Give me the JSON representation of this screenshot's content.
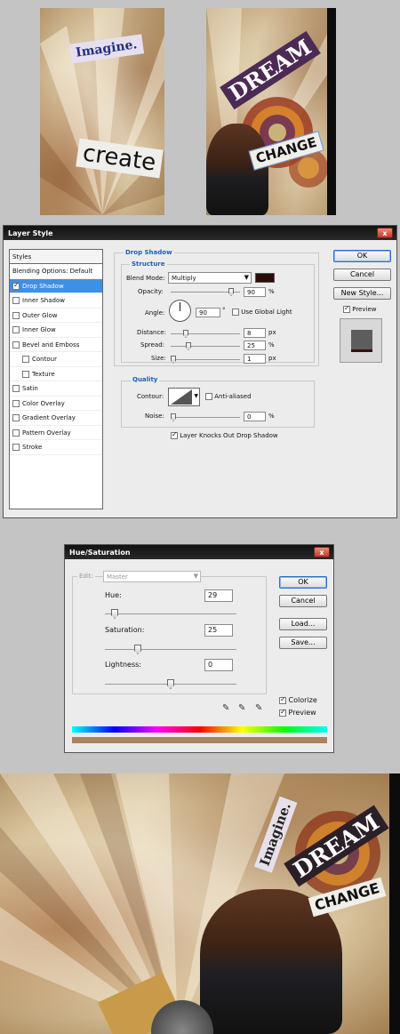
{
  "artwork": {
    "panel1_words": [
      "Imagine.",
      "create"
    ],
    "panel2_words": [
      "DREAM",
      "CHANGE"
    ],
    "final_words": [
      "Imagine.",
      "DREAM",
      "CHANGE"
    ]
  },
  "layer_style": {
    "title": "Layer Style",
    "close_symbol": "x",
    "list_header": "Styles",
    "items": [
      {
        "label": "Blending Options: Default",
        "checkbox": false,
        "checked": false,
        "selected": false,
        "indent": false
      },
      {
        "label": "Drop Shadow",
        "checkbox": true,
        "checked": true,
        "selected": true,
        "indent": false
      },
      {
        "label": "Inner Shadow",
        "checkbox": true,
        "checked": false,
        "selected": false,
        "indent": false
      },
      {
        "label": "Outer Glow",
        "checkbox": true,
        "checked": false,
        "selected": false,
        "indent": false
      },
      {
        "label": "Inner Glow",
        "checkbox": true,
        "checked": false,
        "selected": false,
        "indent": false
      },
      {
        "label": "Bevel and Emboss",
        "checkbox": true,
        "checked": false,
        "selected": false,
        "indent": false
      },
      {
        "label": "Contour",
        "checkbox": true,
        "checked": false,
        "selected": false,
        "indent": true
      },
      {
        "label": "Texture",
        "checkbox": true,
        "checked": false,
        "selected": false,
        "indent": true
      },
      {
        "label": "Satin",
        "checkbox": true,
        "checked": false,
        "selected": false,
        "indent": false
      },
      {
        "label": "Color Overlay",
        "checkbox": true,
        "checked": false,
        "selected": false,
        "indent": false
      },
      {
        "label": "Gradient Overlay",
        "checkbox": true,
        "checked": false,
        "selected": false,
        "indent": false
      },
      {
        "label": "Pattern Overlay",
        "checkbox": true,
        "checked": false,
        "selected": false,
        "indent": false
      },
      {
        "label": "Stroke",
        "checkbox": true,
        "checked": false,
        "selected": false,
        "indent": false
      }
    ],
    "section_title": "Drop Shadow",
    "structure_title": "Structure",
    "blend_mode_label": "Blend Mode:",
    "blend_mode_value": "Multiply",
    "shadow_color": "#2a0c08",
    "opacity_label": "Opacity:",
    "opacity_value": "90",
    "opacity_level": 0.9,
    "percent": "%",
    "angle_label": "Angle:",
    "angle_value": "90",
    "degree": "°",
    "use_global_light": "Use Global Light",
    "distance_label": "Distance:",
    "distance_value": "8",
    "spread_label": "Spread:",
    "spread_value": "25",
    "size_label": "Size:",
    "size_value": "1",
    "px": "px",
    "quality_title": "Quality",
    "contour_label": "Contour:",
    "anti_aliased": "Anti-aliased",
    "noise_label": "Noise:",
    "noise_value": "0",
    "knocks_out": "Layer Knocks Out Drop Shadow",
    "buttons": {
      "ok": "OK",
      "cancel": "Cancel",
      "new_style": "New Style..."
    },
    "preview_label": "Preview"
  },
  "hue_saturation": {
    "title": "Hue/Saturation",
    "close_symbol": "x",
    "edit_label": "Edit:",
    "edit_value": "Master",
    "hue_label": "Hue:",
    "hue_value": "29",
    "saturation_label": "Saturation:",
    "saturation_value": "25",
    "lightness_label": "Lightness:",
    "lightness_value": "0",
    "buttons": {
      "ok": "OK",
      "cancel": "Cancel",
      "load": "Load...",
      "save": "Save..."
    },
    "colorize_label": "Colorize",
    "preview_label": "Preview",
    "colorize_color": "#a88463"
  }
}
